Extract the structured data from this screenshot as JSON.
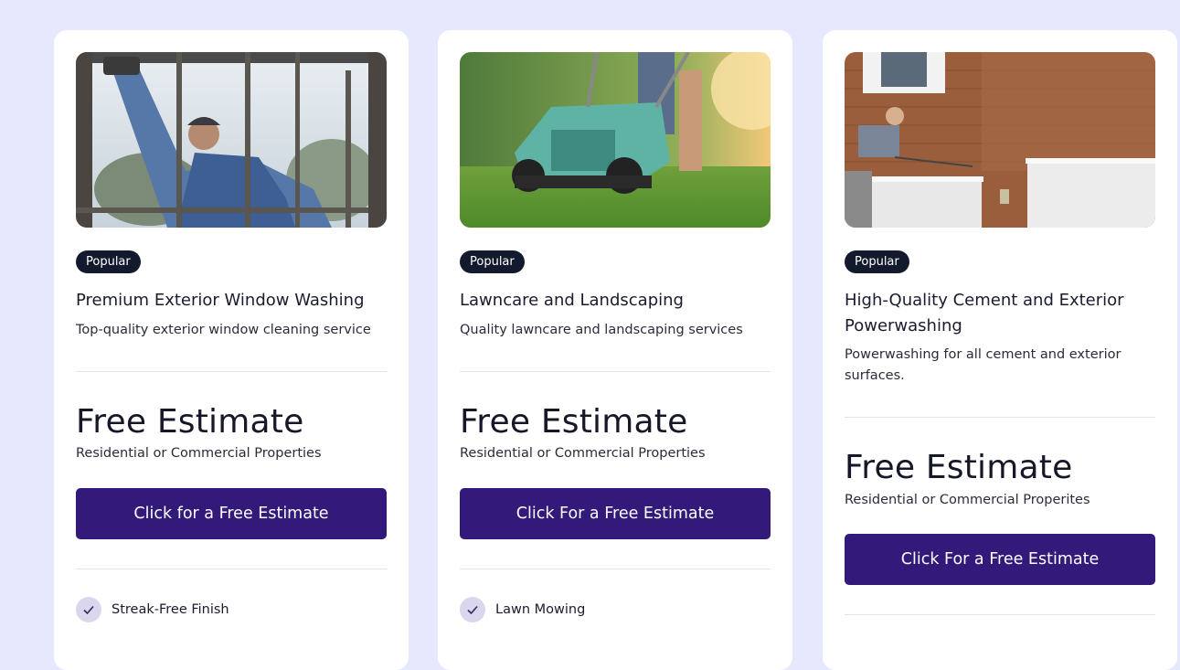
{
  "cards": [
    {
      "image_icon": "window-washing-photo",
      "badge": "Popular",
      "title": "Premium Exterior Window Washing",
      "description": "Top-quality exterior window cleaning service",
      "price": "Free Estimate",
      "subprice": "Residential or Commercial Properties",
      "cta": "Click for a Free Estimate",
      "features": [
        "Streak-Free Finish"
      ]
    },
    {
      "image_icon": "lawn-mower-photo",
      "badge": "Popular",
      "title": "Lawncare and Landscaping",
      "description": "Quality lawncare and landscaping services",
      "price": "Free Estimate",
      "subprice": "Residential or Commercial Properties",
      "cta": "Click For a Free Estimate",
      "features": [
        "Lawn Mowing"
      ]
    },
    {
      "image_icon": "powerwashing-photo",
      "badge": "Popular",
      "title": "High-Quality Cement and Exterior Powerwashing",
      "description": "Powerwashing for all cement and exterior surfaces.",
      "price": "Free Estimate",
      "subprice": "Residential or Commercial Properites",
      "cta": "Click For a Free Estimate",
      "features": []
    }
  ],
  "colors": {
    "page_background": "#e6e9fd",
    "card_background": "#ffffff",
    "badge_background": "#141a2e",
    "cta_background": "#32197a",
    "check_background": "#d9d6ee"
  }
}
